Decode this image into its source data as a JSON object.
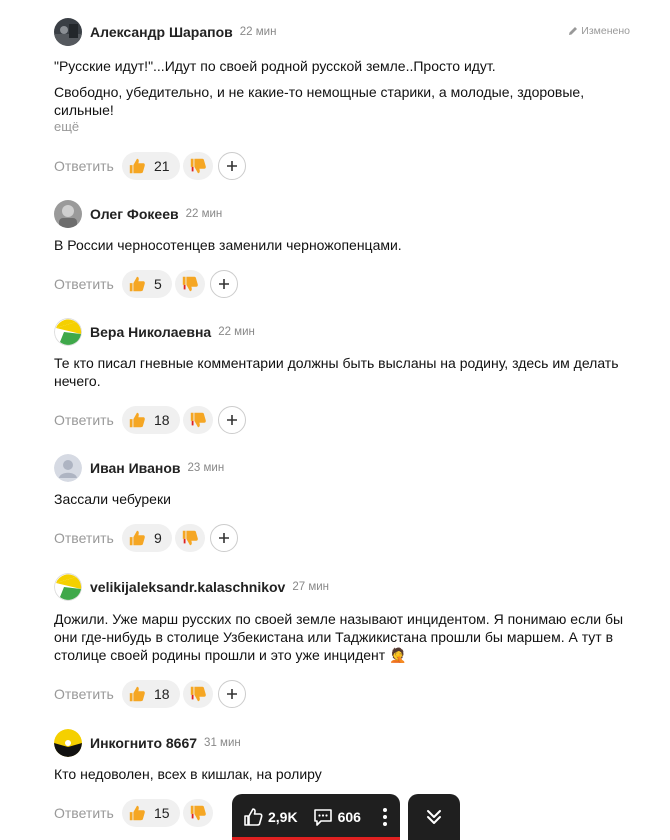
{
  "comments": [
    {
      "author": "Александр Шарапов",
      "time": "22 мин",
      "edited": "Изменено",
      "paragraphs": [
        "\"Русские идут!\"...Идут по своей родной русской земле..Просто идут.",
        "Свободно, убедительно, и не какие-то немощные старики, а молодые, здоровые, сильные!"
      ],
      "more": "ещё",
      "reply": "Ответить",
      "likes": "21",
      "avatar": "photo-dark"
    },
    {
      "author": "Олег Фокеев",
      "time": "22 мин",
      "paragraphs": [
        "В России черносотенцев заменили черножопенцами."
      ],
      "reply": "Ответить",
      "likes": "5",
      "avatar": "photo-grey"
    },
    {
      "author": "Вера Николаевна",
      "time": "22 мин",
      "paragraphs": [
        "Те кто писал гневные комментарии должны быть высланы на родину, здесь им делать нечего."
      ],
      "reply": "Ответить",
      "likes": "18",
      "avatar": "zen-yellow-green"
    },
    {
      "author": "Иван Иванов",
      "time": "23 мин",
      "paragraphs": [
        "Зассали чебуреки"
      ],
      "reply": "Ответить",
      "likes": "9",
      "avatar": "default-user"
    },
    {
      "author": "velikijaleksandr.kalaschnikov",
      "time": "27 мин",
      "paragraphs": [
        "Дожили. Уже марш русских по своей земле называют инцидентом. Я понимаю если бы они где-нибудь в столице Узбекистана или Таджикистана прошли бы маршем. А тут в столице своей родины прошли и это уже инцидент 🤦"
      ],
      "reply": "Ответить",
      "likes": "18",
      "avatar": "zen-yellow-green"
    },
    {
      "author": "Инкогнито 8667",
      "time": "31 мин",
      "paragraphs": [
        "Кто недоволен, всех в кишлак, на ролиру"
      ],
      "reply": "Ответить",
      "likes": "15",
      "avatar": "zen-yellow-black"
    }
  ],
  "bottom_bar": {
    "likes_count": "2,9K",
    "comments_count": "606"
  },
  "colors": {
    "thumb_up": "#f5a623",
    "thumb_down": "#f5a623",
    "bar_bg": "#1f1f1f",
    "accent_red": "#e02020"
  },
  "icons": [
    "pencil-icon",
    "thumbs-up-icon",
    "thumbs-down-icon",
    "plus-icon",
    "like-outline-icon",
    "comment-icon",
    "more-vertical-icon",
    "double-chevron-down-icon"
  ]
}
